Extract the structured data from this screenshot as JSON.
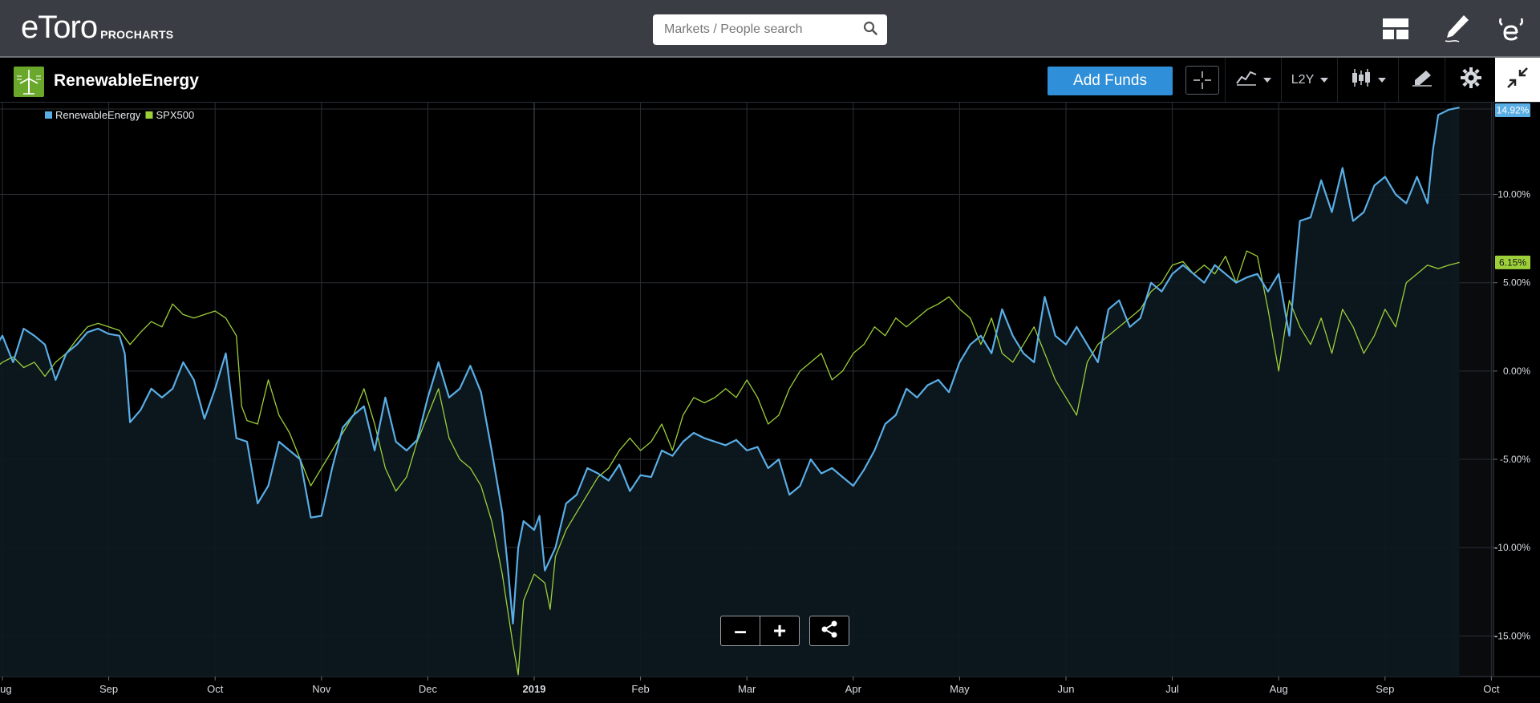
{
  "header": {
    "brand": "eToro",
    "product": "PROCHARTS",
    "search_placeholder": "Markets / People search"
  },
  "toolbar": {
    "instrument_name": "RenewableEnergy",
    "add_funds_label": "Add Funds",
    "timeframe_label": "L2Y"
  },
  "colors": {
    "renewable": "#5aaee6",
    "spx": "#9ccf3a",
    "accent": "#2f8fd8"
  },
  "chart_data": {
    "type": "line",
    "legend_position": "top-left",
    "grid": true,
    "y_unit": "%",
    "ylim": [
      -17.3,
      15.2
    ],
    "x_ticks": [
      "Aug",
      "Sep",
      "Oct",
      "Nov",
      "Dec",
      "2019",
      "Feb",
      "Mar",
      "Apr",
      "May",
      "Jun",
      "Jul",
      "Aug",
      "Sep",
      "Oct"
    ],
    "x_tick_pos": [
      0,
      1,
      2,
      3,
      4,
      5,
      6,
      7,
      8,
      9,
      10,
      11,
      12,
      13,
      14
    ],
    "xlim": [
      -0.1,
      13.84
    ],
    "y_ticks": [
      "10.00%",
      "5.00%",
      "0.00%",
      "-5.00%",
      "-10.00%",
      "-15.00%"
    ],
    "y_tick_values": [
      10,
      5,
      0,
      -5,
      -10,
      -15
    ],
    "series": [
      {
        "name": "RenewableEnergy",
        "last_label": "14.92%",
        "points": [
          [
            -0.1,
            1.0
          ],
          [
            0,
            2.0
          ],
          [
            0.1,
            0.5
          ],
          [
            0.2,
            2.4
          ],
          [
            0.3,
            2.0
          ],
          [
            0.4,
            1.5
          ],
          [
            0.5,
            -0.5
          ],
          [
            0.6,
            1.0
          ],
          [
            0.7,
            1.5
          ],
          [
            0.8,
            2.2
          ],
          [
            0.9,
            2.4
          ],
          [
            1.0,
            2.1
          ],
          [
            1.1,
            2.0
          ],
          [
            1.15,
            1.0
          ],
          [
            1.2,
            -2.9
          ],
          [
            1.3,
            -2.2
          ],
          [
            1.4,
            -1.0
          ],
          [
            1.5,
            -1.5
          ],
          [
            1.6,
            -1.0
          ],
          [
            1.7,
            0.5
          ],
          [
            1.8,
            -0.5
          ],
          [
            1.9,
            -2.7
          ],
          [
            2.0,
            -1.0
          ],
          [
            2.1,
            1.0
          ],
          [
            2.2,
            -3.8
          ],
          [
            2.3,
            -4.0
          ],
          [
            2.4,
            -7.5
          ],
          [
            2.5,
            -6.5
          ],
          [
            2.6,
            -4.0
          ],
          [
            2.7,
            -4.5
          ],
          [
            2.8,
            -5.0
          ],
          [
            2.9,
            -8.3
          ],
          [
            3.0,
            -8.2
          ],
          [
            3.1,
            -5.5
          ],
          [
            3.2,
            -3.2
          ],
          [
            3.3,
            -2.5
          ],
          [
            3.4,
            -2.0
          ],
          [
            3.5,
            -4.5
          ],
          [
            3.6,
            -1.5
          ],
          [
            3.7,
            -4.0
          ],
          [
            3.8,
            -4.5
          ],
          [
            3.9,
            -3.9
          ],
          [
            4.0,
            -1.5
          ],
          [
            4.1,
            0.5
          ],
          [
            4.2,
            -1.5
          ],
          [
            4.3,
            -1.0
          ],
          [
            4.4,
            0.3
          ],
          [
            4.5,
            -1.2
          ],
          [
            4.6,
            -4.5
          ],
          [
            4.7,
            -8.0
          ],
          [
            4.75,
            -11.0
          ],
          [
            4.8,
            -14.3
          ],
          [
            4.85,
            -10.0
          ],
          [
            4.9,
            -8.5
          ],
          [
            5.0,
            -9.0
          ],
          [
            5.05,
            -8.2
          ],
          [
            5.1,
            -11.3
          ],
          [
            5.2,
            -10.0
          ],
          [
            5.3,
            -7.5
          ],
          [
            5.4,
            -7.0
          ],
          [
            5.5,
            -5.5
          ],
          [
            5.6,
            -5.8
          ],
          [
            5.7,
            -6.2
          ],
          [
            5.8,
            -5.3
          ],
          [
            5.9,
            -6.8
          ],
          [
            6.0,
            -5.9
          ],
          [
            6.1,
            -6.0
          ],
          [
            6.2,
            -4.5
          ],
          [
            6.3,
            -4.8
          ],
          [
            6.4,
            -4.0
          ],
          [
            6.5,
            -3.5
          ],
          [
            6.6,
            -3.8
          ],
          [
            6.7,
            -4.0
          ],
          [
            6.8,
            -4.2
          ],
          [
            6.9,
            -3.9
          ],
          [
            7.0,
            -4.5
          ],
          [
            7.1,
            -4.3
          ],
          [
            7.2,
            -5.5
          ],
          [
            7.3,
            -5.0
          ],
          [
            7.4,
            -7.0
          ],
          [
            7.5,
            -6.5
          ],
          [
            7.6,
            -5.0
          ],
          [
            7.7,
            -5.8
          ],
          [
            7.8,
            -5.5
          ],
          [
            7.9,
            -6.0
          ],
          [
            8.0,
            -6.5
          ],
          [
            8.1,
            -5.6
          ],
          [
            8.2,
            -4.5
          ],
          [
            8.3,
            -3.0
          ],
          [
            8.4,
            -2.5
          ],
          [
            8.5,
            -1.0
          ],
          [
            8.6,
            -1.5
          ],
          [
            8.7,
            -0.8
          ],
          [
            8.8,
            -0.5
          ],
          [
            8.9,
            -1.2
          ],
          [
            9.0,
            0.5
          ],
          [
            9.1,
            1.5
          ],
          [
            9.2,
            2.0
          ],
          [
            9.3,
            1.0
          ],
          [
            9.4,
            3.5
          ],
          [
            9.5,
            2.0
          ],
          [
            9.6,
            1.0
          ],
          [
            9.7,
            0.5
          ],
          [
            9.8,
            4.2
          ],
          [
            9.9,
            2.0
          ],
          [
            10.0,
            1.5
          ],
          [
            10.1,
            2.5
          ],
          [
            10.2,
            1.5
          ],
          [
            10.3,
            0.5
          ],
          [
            10.4,
            3.5
          ],
          [
            10.5,
            4.0
          ],
          [
            10.6,
            2.5
          ],
          [
            10.7,
            3.0
          ],
          [
            10.8,
            5.0
          ],
          [
            10.9,
            4.5
          ],
          [
            11.0,
            5.5
          ],
          [
            11.1,
            6.0
          ],
          [
            11.2,
            5.5
          ],
          [
            11.3,
            5.0
          ],
          [
            11.4,
            6.0
          ],
          [
            11.5,
            5.5
          ],
          [
            11.6,
            5.0
          ],
          [
            11.7,
            5.3
          ],
          [
            11.8,
            5.5
          ],
          [
            11.9,
            4.5
          ],
          [
            12.0,
            5.5
          ],
          [
            12.1,
            2.0
          ],
          [
            12.2,
            8.5
          ],
          [
            12.3,
            8.7
          ],
          [
            12.4,
            10.8
          ],
          [
            12.5,
            9.0
          ],
          [
            12.6,
            11.5
          ],
          [
            12.7,
            8.5
          ],
          [
            12.8,
            9.0
          ],
          [
            12.9,
            10.5
          ],
          [
            13.0,
            11.0
          ],
          [
            13.1,
            10.0
          ],
          [
            13.2,
            9.5
          ],
          [
            13.3,
            11.0
          ],
          [
            13.4,
            9.5
          ],
          [
            13.45,
            12.5
          ],
          [
            13.5,
            14.5
          ],
          [
            13.6,
            14.8
          ],
          [
            13.7,
            14.92
          ]
        ]
      },
      {
        "name": "SPX500",
        "last_label": "6.15%",
        "points": [
          [
            -0.1,
            0.0
          ],
          [
            0,
            0.5
          ],
          [
            0.1,
            0.8
          ],
          [
            0.2,
            0.2
          ],
          [
            0.3,
            0.5
          ],
          [
            0.4,
            -0.3
          ],
          [
            0.5,
            0.5
          ],
          [
            0.6,
            1.0
          ],
          [
            0.7,
            1.8
          ],
          [
            0.8,
            2.5
          ],
          [
            0.9,
            2.7
          ],
          [
            1.0,
            2.5
          ],
          [
            1.1,
            2.3
          ],
          [
            1.2,
            1.5
          ],
          [
            1.3,
            2.2
          ],
          [
            1.4,
            2.8
          ],
          [
            1.5,
            2.5
          ],
          [
            1.6,
            3.8
          ],
          [
            1.7,
            3.2
          ],
          [
            1.8,
            3.0
          ],
          [
            1.9,
            3.2
          ],
          [
            2.0,
            3.4
          ],
          [
            2.1,
            3.0
          ],
          [
            2.2,
            2.0
          ],
          [
            2.25,
            -2.0
          ],
          [
            2.3,
            -2.8
          ],
          [
            2.4,
            -3.0
          ],
          [
            2.5,
            -0.5
          ],
          [
            2.6,
            -2.5
          ],
          [
            2.7,
            -3.5
          ],
          [
            2.8,
            -5.0
          ],
          [
            2.9,
            -6.5
          ],
          [
            3.0,
            -5.5
          ],
          [
            3.1,
            -4.5
          ],
          [
            3.2,
            -3.5
          ],
          [
            3.3,
            -2.5
          ],
          [
            3.4,
            -1.0
          ],
          [
            3.5,
            -3.0
          ],
          [
            3.6,
            -5.5
          ],
          [
            3.7,
            -6.8
          ],
          [
            3.8,
            -6.0
          ],
          [
            3.9,
            -4.0
          ],
          [
            4.0,
            -2.5
          ],
          [
            4.1,
            -1.0
          ],
          [
            4.2,
            -3.8
          ],
          [
            4.3,
            -5.0
          ],
          [
            4.4,
            -5.5
          ],
          [
            4.5,
            -6.5
          ],
          [
            4.6,
            -8.5
          ],
          [
            4.7,
            -11.5
          ],
          [
            4.8,
            -15.5
          ],
          [
            4.85,
            -17.2
          ],
          [
            4.9,
            -13.0
          ],
          [
            5.0,
            -11.5
          ],
          [
            5.1,
            -12.0
          ],
          [
            5.15,
            -13.5
          ],
          [
            5.2,
            -10.5
          ],
          [
            5.3,
            -9.0
          ],
          [
            5.4,
            -8.0
          ],
          [
            5.5,
            -7.0
          ],
          [
            5.6,
            -6.0
          ],
          [
            5.7,
            -5.5
          ],
          [
            5.8,
            -4.5
          ],
          [
            5.9,
            -3.8
          ],
          [
            6.0,
            -4.5
          ],
          [
            6.1,
            -4.0
          ],
          [
            6.2,
            -3.0
          ],
          [
            6.3,
            -4.5
          ],
          [
            6.4,
            -2.5
          ],
          [
            6.5,
            -1.5
          ],
          [
            6.6,
            -1.8
          ],
          [
            6.7,
            -1.5
          ],
          [
            6.8,
            -1.0
          ],
          [
            6.9,
            -1.5
          ],
          [
            7.0,
            -0.5
          ],
          [
            7.1,
            -1.5
          ],
          [
            7.2,
            -3.0
          ],
          [
            7.3,
            -2.5
          ],
          [
            7.4,
            -1.0
          ],
          [
            7.5,
            0.0
          ],
          [
            7.6,
            0.5
          ],
          [
            7.7,
            1.0
          ],
          [
            7.8,
            -0.5
          ],
          [
            7.9,
            0.0
          ],
          [
            8.0,
            1.0
          ],
          [
            8.1,
            1.5
          ],
          [
            8.2,
            2.5
          ],
          [
            8.3,
            2.0
          ],
          [
            8.4,
            3.0
          ],
          [
            8.5,
            2.5
          ],
          [
            8.6,
            3.0
          ],
          [
            8.7,
            3.5
          ],
          [
            8.8,
            3.8
          ],
          [
            8.9,
            4.2
          ],
          [
            9.0,
            3.5
          ],
          [
            9.1,
            3.0
          ],
          [
            9.2,
            1.5
          ],
          [
            9.3,
            3.0
          ],
          [
            9.4,
            1.0
          ],
          [
            9.5,
            0.5
          ],
          [
            9.6,
            1.5
          ],
          [
            9.7,
            2.5
          ],
          [
            9.8,
            1.0
          ],
          [
            9.9,
            -0.5
          ],
          [
            10.0,
            -1.5
          ],
          [
            10.1,
            -2.5
          ],
          [
            10.2,
            0.5
          ],
          [
            10.3,
            1.5
          ],
          [
            10.4,
            2.0
          ],
          [
            10.5,
            2.5
          ],
          [
            10.6,
            3.0
          ],
          [
            10.7,
            3.5
          ],
          [
            10.8,
            4.5
          ],
          [
            10.9,
            5.0
          ],
          [
            11.0,
            6.0
          ],
          [
            11.1,
            6.2
          ],
          [
            11.2,
            5.5
          ],
          [
            11.3,
            6.0
          ],
          [
            11.4,
            5.5
          ],
          [
            11.5,
            6.5
          ],
          [
            11.6,
            5.0
          ],
          [
            11.7,
            6.8
          ],
          [
            11.8,
            6.5
          ],
          [
            11.9,
            3.5
          ],
          [
            12.0,
            0.0
          ],
          [
            12.1,
            4.0
          ],
          [
            12.2,
            2.5
          ],
          [
            12.3,
            1.5
          ],
          [
            12.4,
            3.0
          ],
          [
            12.5,
            1.0
          ],
          [
            12.6,
            3.5
          ],
          [
            12.7,
            2.5
          ],
          [
            12.8,
            1.0
          ],
          [
            12.9,
            2.0
          ],
          [
            13.0,
            3.5
          ],
          [
            13.1,
            2.5
          ],
          [
            13.2,
            5.0
          ],
          [
            13.3,
            5.5
          ],
          [
            13.4,
            6.0
          ],
          [
            13.5,
            5.8
          ],
          [
            13.6,
            6.0
          ],
          [
            13.7,
            6.15
          ]
        ]
      }
    ]
  }
}
